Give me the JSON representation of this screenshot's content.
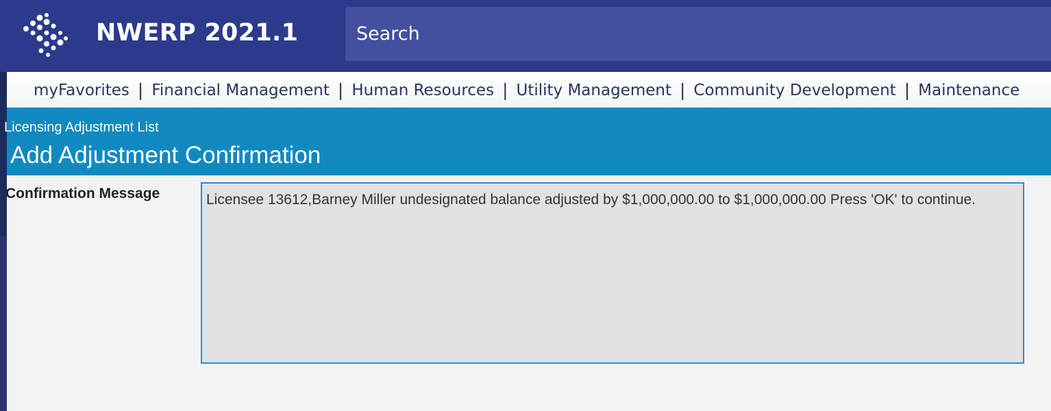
{
  "header": {
    "app_title": "NWERP 2021.1",
    "search_placeholder": "Search",
    "logo_icon": "dots-diamond-logo-icon"
  },
  "menu": {
    "items": [
      {
        "label": "myFavorites"
      },
      {
        "label": "Financial Management"
      },
      {
        "label": "Human Resources"
      },
      {
        "label": "Utility Management"
      },
      {
        "label": "Community Development"
      },
      {
        "label": "Maintenance"
      }
    ],
    "separator": "|"
  },
  "page": {
    "breadcrumb": "Licensing Adjustment List",
    "title": "Add Adjustment Confirmation"
  },
  "form": {
    "confirmation_label": "Confirmation Message",
    "confirmation_text": "Licensee 13612,Barney Miller undesignated balance adjusted by $1,000,000.00 to $1,000,000.00 Press 'OK' to continue."
  },
  "colors": {
    "header_bg": "#2c3a8c",
    "search_bg": "#4350a0",
    "page_band": "#1089c0",
    "message_border": "#2e8ad4"
  }
}
